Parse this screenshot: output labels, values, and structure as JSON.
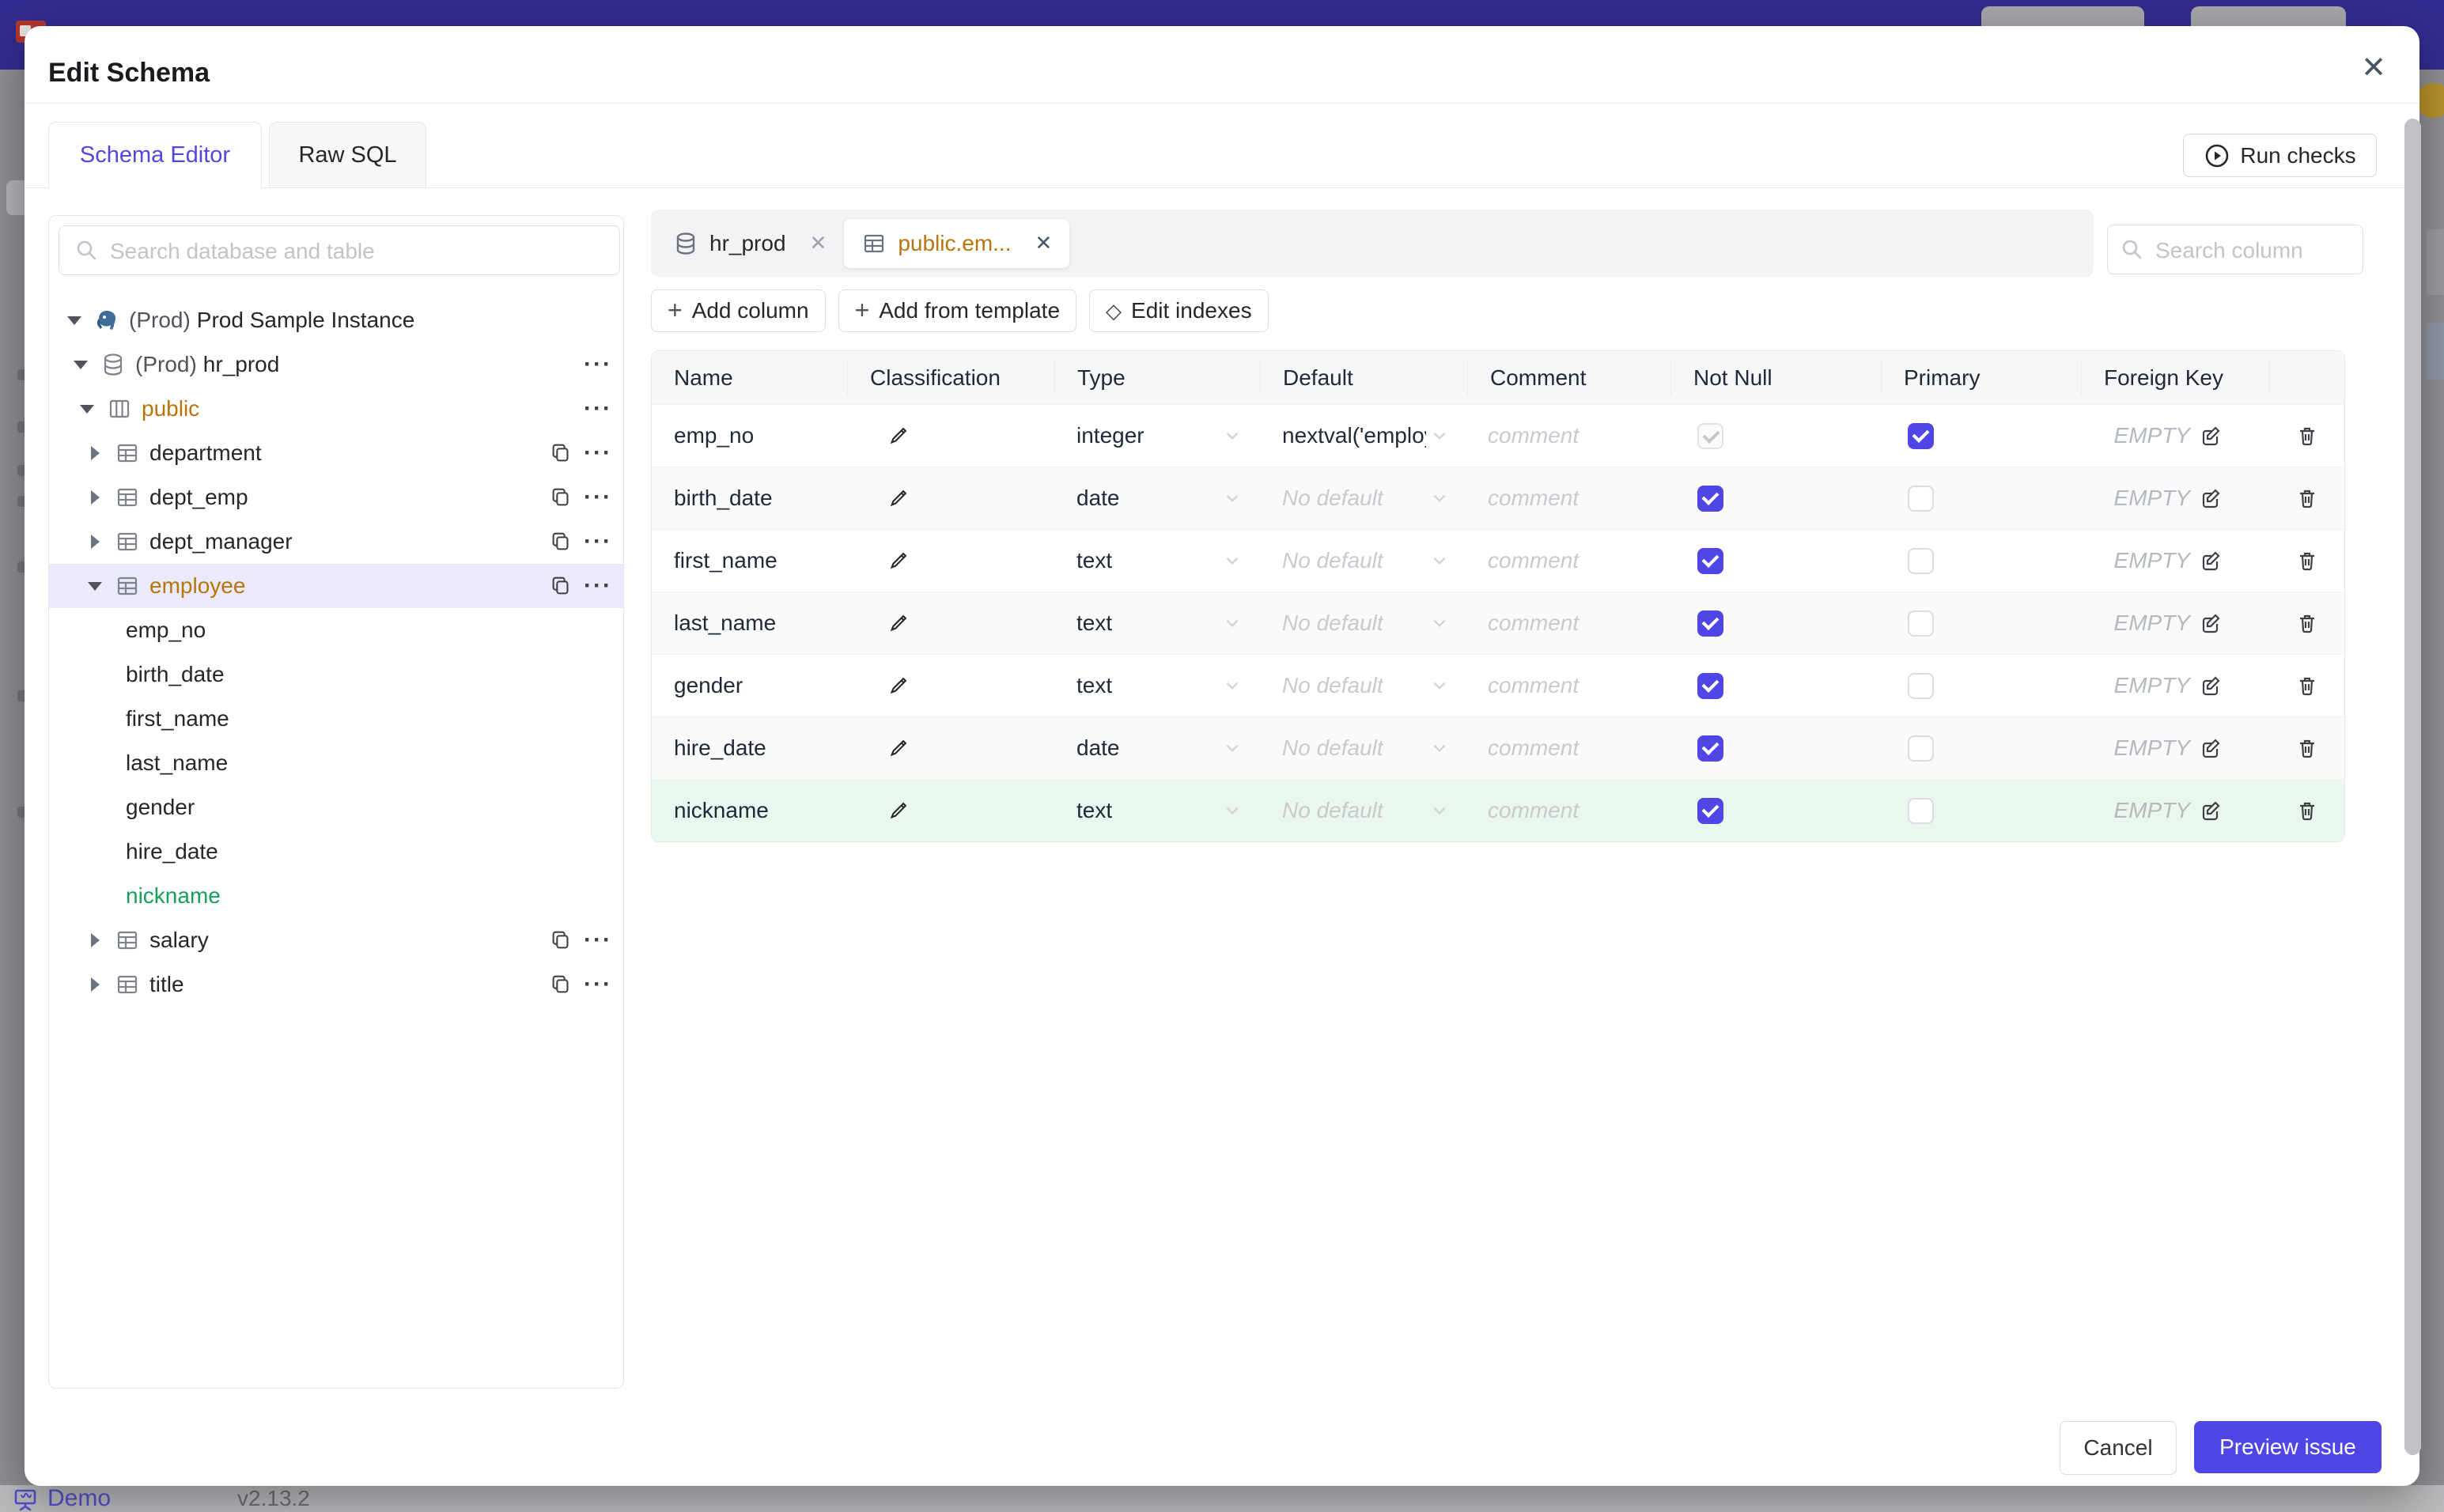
{
  "modal": {
    "title": "Edit Schema",
    "close_label": "✕",
    "tabs": [
      {
        "label": "Schema Editor",
        "active": true
      },
      {
        "label": "Raw SQL",
        "active": false
      }
    ],
    "run_checks_label": "Run checks"
  },
  "sidebar": {
    "search_placeholder": "Search database and table",
    "tree": [
      {
        "type": "instance",
        "level": 0,
        "caret": "down",
        "icon": "postgres",
        "prefix": "(Prod)",
        "label": "Prod Sample Instance",
        "copy": false,
        "more": false
      },
      {
        "type": "database",
        "level": 1,
        "caret": "down",
        "icon": "database",
        "prefix": "(Prod)",
        "label": "hr_prod",
        "copy": false,
        "more": true
      },
      {
        "type": "schema",
        "level": 2,
        "caret": "down",
        "icon": "schema",
        "prefix": "",
        "label": "public",
        "state": "modified",
        "copy": false,
        "more": true
      },
      {
        "type": "table",
        "level": 3,
        "caret": "right",
        "icon": "table",
        "prefix": "",
        "label": "department",
        "copy": true,
        "more": true
      },
      {
        "type": "table",
        "level": 3,
        "caret": "right",
        "icon": "table",
        "prefix": "",
        "label": "dept_emp",
        "copy": true,
        "more": true
      },
      {
        "type": "table",
        "level": 3,
        "caret": "right",
        "icon": "table",
        "prefix": "",
        "label": "dept_manager",
        "copy": true,
        "more": true
      },
      {
        "type": "table",
        "level": 3,
        "caret": "down",
        "icon": "table",
        "prefix": "",
        "label": "employee",
        "state": "modified",
        "selected": true,
        "copy": true,
        "more": true
      },
      {
        "type": "column",
        "level": 4,
        "caret": "none",
        "icon": "none",
        "prefix": "",
        "label": "emp_no"
      },
      {
        "type": "column",
        "level": 4,
        "caret": "none",
        "icon": "none",
        "prefix": "",
        "label": "birth_date"
      },
      {
        "type": "column",
        "level": 4,
        "caret": "none",
        "icon": "none",
        "prefix": "",
        "label": "first_name"
      },
      {
        "type": "column",
        "level": 4,
        "caret": "none",
        "icon": "none",
        "prefix": "",
        "label": "last_name"
      },
      {
        "type": "column",
        "level": 4,
        "caret": "none",
        "icon": "none",
        "prefix": "",
        "label": "gender"
      },
      {
        "type": "column",
        "level": 4,
        "caret": "none",
        "icon": "none",
        "prefix": "",
        "label": "hire_date"
      },
      {
        "type": "column",
        "level": 4,
        "caret": "none",
        "icon": "none",
        "prefix": "",
        "label": "nickname",
        "state": "new"
      },
      {
        "type": "table",
        "level": 3,
        "caret": "right",
        "icon": "table",
        "prefix": "",
        "label": "salary",
        "copy": true,
        "more": true
      },
      {
        "type": "table",
        "level": 3,
        "caret": "right",
        "icon": "table",
        "prefix": "",
        "label": "title",
        "copy": true,
        "more": true
      }
    ]
  },
  "editor": {
    "chips": [
      {
        "icon": "database",
        "label": "hr_prod",
        "active": false
      },
      {
        "icon": "table",
        "label": "public.em...",
        "active": true
      }
    ],
    "column_search_placeholder": "Search column",
    "toolbar": {
      "add_column": "Add column",
      "add_from_template": "Add from template",
      "edit_indexes": "Edit indexes"
    },
    "table": {
      "headers": [
        "Name",
        "Classification",
        "Type",
        "Default",
        "Comment",
        "Not Null",
        "Primary",
        "Foreign Key"
      ],
      "comment_placeholder": "comment",
      "foreign_key_empty": "EMPTY",
      "rows": [
        {
          "name": "emp_no",
          "type": "integer",
          "default": "nextval('employ",
          "default_is_placeholder": false,
          "not_null": {
            "checked": true,
            "disabled": true
          },
          "primary": {
            "checked": true
          },
          "highlight": false
        },
        {
          "name": "birth_date",
          "type": "date",
          "default": "No default",
          "default_is_placeholder": true,
          "not_null": {
            "checked": true,
            "disabled": false
          },
          "primary": {
            "checked": false
          },
          "highlight": false
        },
        {
          "name": "first_name",
          "type": "text",
          "default": "No default",
          "default_is_placeholder": true,
          "not_null": {
            "checked": true,
            "disabled": false
          },
          "primary": {
            "checked": false
          },
          "highlight": false
        },
        {
          "name": "last_name",
          "type": "text",
          "default": "No default",
          "default_is_placeholder": true,
          "not_null": {
            "checked": true,
            "disabled": false
          },
          "primary": {
            "checked": false
          },
          "highlight": false
        },
        {
          "name": "gender",
          "type": "text",
          "default": "No default",
          "default_is_placeholder": true,
          "not_null": {
            "checked": true,
            "disabled": false
          },
          "primary": {
            "checked": false
          },
          "highlight": false
        },
        {
          "name": "hire_date",
          "type": "date",
          "default": "No default",
          "default_is_placeholder": true,
          "not_null": {
            "checked": true,
            "disabled": false
          },
          "primary": {
            "checked": false
          },
          "highlight": false
        },
        {
          "name": "nickname",
          "type": "text",
          "default": "No default",
          "default_is_placeholder": true,
          "not_null": {
            "checked": true,
            "disabled": false
          },
          "primary": {
            "checked": false
          },
          "highlight": true
        }
      ]
    }
  },
  "footer": {
    "cancel_label": "Cancel",
    "primary_label": "Preview issue"
  },
  "background": {
    "demo_label": "Demo",
    "version": "v2.13.2"
  },
  "colors": {
    "topbar": "#312c8f",
    "accent_indigo": "#5046e5",
    "modified_orange": "#b8750c",
    "new_green": "#18a058",
    "selected_row": "#eaeafb",
    "new_row_bg": "#e9f7ee"
  }
}
